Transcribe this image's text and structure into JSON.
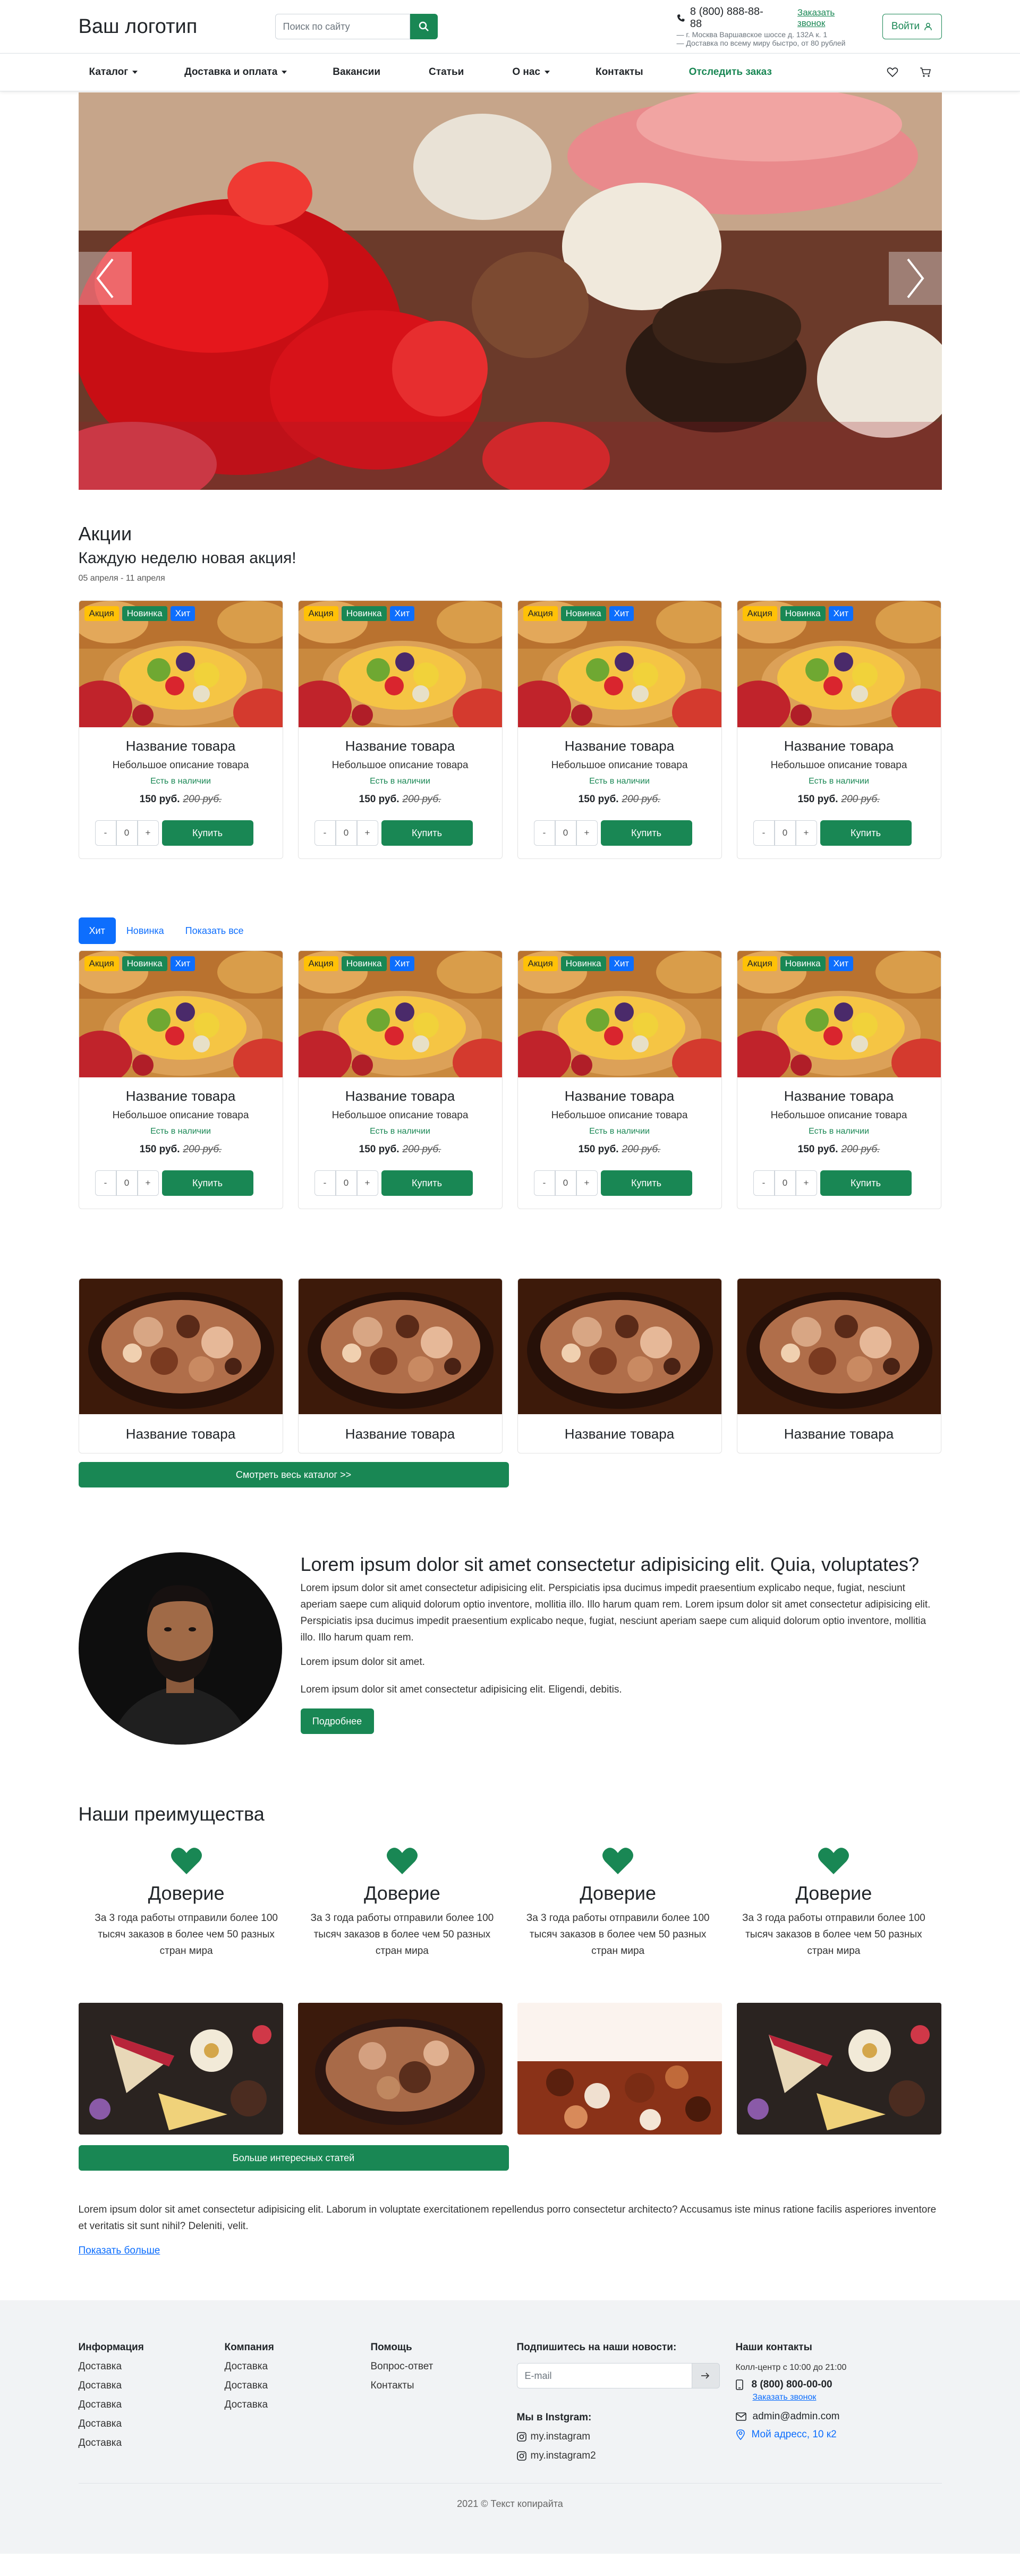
{
  "header": {
    "logo": "Ваш логотип",
    "search_placeholder": "Поиск по сайту",
    "phone": "8 (800) 888-88-88",
    "callback": "Заказать звонок",
    "address": "— г. Москва Варшавское шоссе д. 132А к. 1",
    "delivery": "— Доставка по всему миру быстро, от 80 рублей",
    "login": "Войти"
  },
  "nav": {
    "catalog": "Каталог",
    "delivery": "Доставка и оплата",
    "vacancies": "Вакансии",
    "articles": "Статьи",
    "about": "О нас",
    "contacts": "Контакты",
    "track": "Отследить заказ"
  },
  "promo": {
    "title": "Акции",
    "subtitle": "Каждую неделю новая акция!",
    "dates": "05 апреля - 11 апреля"
  },
  "product": {
    "badge_sale": "Акция",
    "badge_new": "Новинка",
    "badge_hit": "Хит",
    "title": "Название товара",
    "desc": "Небольшое описание товара",
    "stock": "Есть в наличии",
    "price": "150 руб.",
    "old_price": "200 руб.",
    "minus": "-",
    "qty": "0",
    "plus": "+",
    "buy": "Купить"
  },
  "tabs": {
    "hit": "Хит",
    "new": "Новинка",
    "all": "Показать все"
  },
  "catalog": {
    "item_title": "Название товара",
    "button": "Смотреть весь каталог >>"
  },
  "about": {
    "title": "Lorem ipsum dolor sit amet consectetur adipisicing elit. Quia, voluptates?",
    "text": "Lorem ipsum dolor sit amet consectetur adipisicing elit. Perspiciatis ipsa ducimus impedit praesentium explicabo neque, fugiat, nesciunt aperiam saepe cum aliquid dolorum optio inventore, mollitia illo. Illo harum quam rem. Lorem ipsum dolor sit amet consectetur adipisicing elit. Perspiciatis ipsa ducimus impedit praesentium explicabo neque, fugiat, nesciunt aperiam saepe cum aliquid dolorum optio inventore, mollitia illo. Illo harum quam rem.",
    "p1": "Lorem ipsum dolor sit amet.",
    "p2": "Lorem ipsum dolor sit amet consectetur adipisicing elit. Eligendi, debitis.",
    "button": "Подробнее"
  },
  "advantages": {
    "title": "Наши преимущества",
    "item_title": "Доверие",
    "item_text": "За 3 года работы отправили более 100 тысяч заказов в более чем 50 разных стран мира"
  },
  "articles": {
    "button": "Больше интересных статей",
    "text": "Lorem ipsum dolor sit amet consectetur adipisicing elit. Laborum in voluptate exercitationem repellendus porro consectetur architecto? Accusamus iste minus ratione facilis asperiores inventore et veritatis sit sunt nihil? Deleniti, velit.",
    "more": "Показать больше"
  },
  "footer": {
    "info_title": "Информация",
    "info_items": [
      "Доставка",
      "Доставка",
      "Доставка",
      "Доставка",
      "Доставка"
    ],
    "company_title": "Компания",
    "company_items": [
      "Доставка",
      "Доставка",
      "Доставка"
    ],
    "help_title": "Помощь",
    "help_items": [
      "Вопрос-ответ",
      "Контакты"
    ],
    "subscribe_title": "Подпишитесь на наши новости:",
    "email_placeholder": "E-mail",
    "insta_title": "Мы в Instgram:",
    "insta_items": [
      "my.instagram",
      "my.instagram2"
    ],
    "contacts_title": "Наши контакты",
    "call_center": "Колл-центр с 10:00 до 21:00",
    "phone": "8 (800) 800-00-00",
    "callback": "Заказать звонок",
    "email": "admin@admin.com",
    "address": "Мой адресс, 10 к2",
    "copyright": "2021 © Текст копирайта"
  }
}
